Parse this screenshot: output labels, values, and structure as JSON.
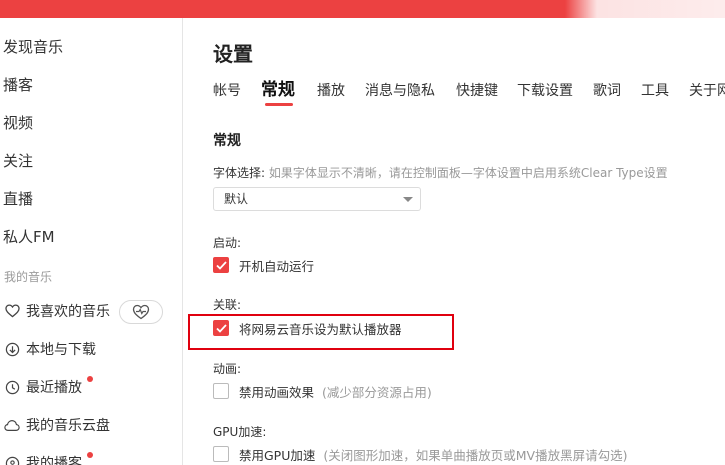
{
  "colors": {
    "brand_red": "#ec4141",
    "highlight_red": "#e0000f"
  },
  "sidebar": {
    "nav": [
      "发现音乐",
      "播客",
      "视频",
      "关注",
      "直播",
      "私人FM"
    ],
    "my_music_label": "我的音乐",
    "my_items": [
      {
        "label": "我喜欢的音乐",
        "icon": "heart-outline-icon"
      },
      {
        "label": "本地与下载",
        "icon": "download-icon"
      },
      {
        "label": "最近播放",
        "icon": "clock-icon",
        "badge": true
      },
      {
        "label": "我的音乐云盘",
        "icon": "cloud-icon"
      },
      {
        "label": "我的播客",
        "icon": "podcast-icon",
        "badge": true
      }
    ],
    "heart_mode_icon": "heartbeat-icon"
  },
  "main": {
    "title": "设置",
    "tabs": [
      "帐号",
      "常规",
      "播放",
      "消息与隐私",
      "快捷键",
      "下载设置",
      "歌词",
      "工具",
      "关于网"
    ],
    "active_tab": "常规",
    "section_title": "常规",
    "font": {
      "label": "字体选择:",
      "hint": "如果字体显示不清晰，请在控制面板—字体设置中启用系统Clear Type设置",
      "selected": "默认"
    },
    "startup": {
      "label": "启动:",
      "option": "开机自动运行",
      "checked": true
    },
    "association": {
      "label": "关联:",
      "option": "将网易云音乐设为默认播放器",
      "checked": true
    },
    "animation": {
      "label": "动画:",
      "option": "禁用动画效果",
      "hint": "(减少部分资源占用)",
      "checked": false
    },
    "gpu": {
      "label": "GPU加速:",
      "option": "禁用GPU加速",
      "hint": "(关闭图形加速，如果单曲播放页或MV播放黑屏请勾选)",
      "checked": false
    }
  }
}
